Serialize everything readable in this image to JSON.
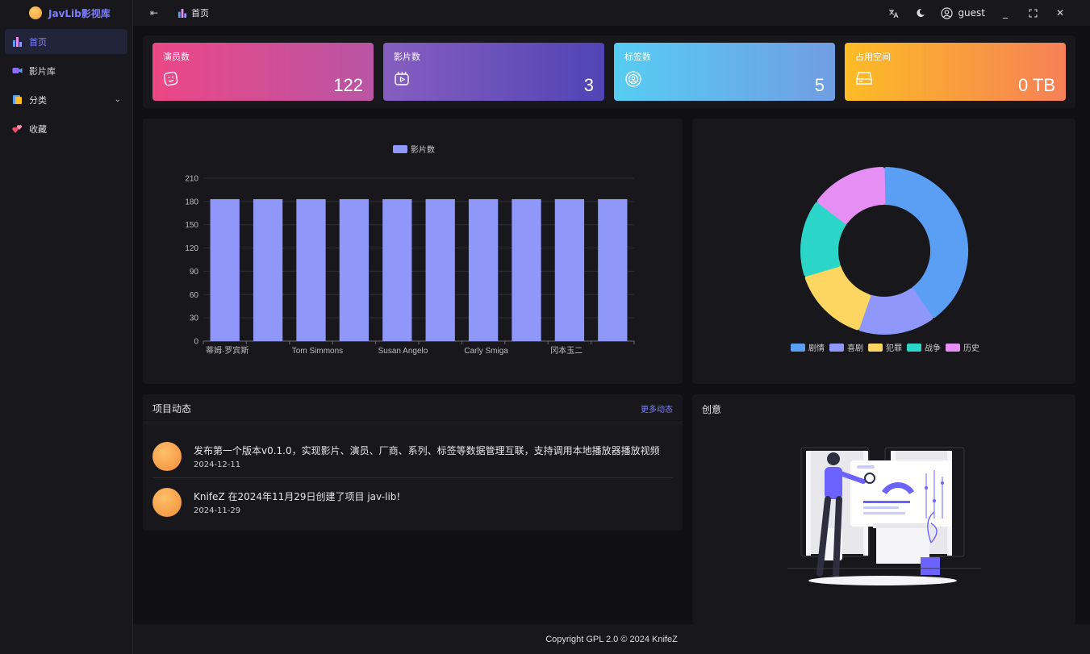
{
  "app": {
    "title": "JavLib影视库"
  },
  "sidebar": {
    "items": [
      {
        "label": "首页",
        "icon": "bar-chart-icon",
        "active": true
      },
      {
        "label": "影片库",
        "icon": "video-camera-icon"
      },
      {
        "label": "分类",
        "icon": "category-icon",
        "has_children": true
      },
      {
        "label": "收藏",
        "icon": "hearts-icon"
      }
    ]
  },
  "header": {
    "breadcrumb": "首页",
    "user_name": "guest"
  },
  "stats": [
    {
      "label": "演员数",
      "value": "122",
      "icon": "face-icon"
    },
    {
      "label": "影片数",
      "value": "3",
      "icon": "film-icon"
    },
    {
      "label": "标签数",
      "value": "5",
      "icon": "tag-icon"
    },
    {
      "label": "占用空间",
      "value": "0 TB",
      "icon": "disk-icon"
    }
  ],
  "chart_data": [
    {
      "type": "bar",
      "legend": [
        "影片数"
      ],
      "categories": [
        "蒂姆·罗宾斯",
        "",
        "Tom Simmons",
        "",
        "Susan Angelo",
        "",
        "Carly Smiga",
        "",
        "冈本玉二",
        ""
      ],
      "tick_labels": [
        "蒂姆·罗宾斯",
        "Tom Simmons",
        "Susan Angelo",
        "Carly Smiga",
        "冈本玉二"
      ],
      "series": [
        {
          "name": "影片数",
          "values": [
            183,
            183,
            183,
            183,
            183,
            183,
            183,
            183,
            183,
            183
          ]
        }
      ],
      "ylim": [
        0,
        210
      ],
      "yticks": [
        0,
        30,
        60,
        90,
        120,
        150,
        180,
        210
      ],
      "grid": true,
      "legend_position": "top-center",
      "color": "#8f97fb"
    },
    {
      "type": "pie",
      "variant": "donut",
      "slices": [
        {
          "name": "剧情",
          "value": 40,
          "color": "#5b9ff5"
        },
        {
          "name": "喜剧",
          "value": 15,
          "color": "#8f97fb"
        },
        {
          "name": "犯罪",
          "value": 15,
          "color": "#fcd660"
        },
        {
          "name": "战争",
          "value": 15,
          "color": "#2bd6c8"
        },
        {
          "name": "历史",
          "value": 15,
          "color": "#e58ff4"
        }
      ],
      "legend_position": "bottom-center"
    }
  ],
  "activity": {
    "title": "项目动态",
    "more_label": "更多动态",
    "items": [
      {
        "text": "发布第一个版本v0.1.0，实现影片、演员、厂商、系列、标签等数据管理互联，支持调用本地播放器播放视频",
        "date": "2024-12-11"
      },
      {
        "text": "KnifeZ 在2024年11月29日创建了项目 jav-lib!",
        "date": "2024-11-29"
      }
    ]
  },
  "idea": {
    "title": "创意"
  },
  "footer": {
    "copyright": "Copyright GPL 2.0 © 2024 KnifeZ"
  },
  "colors": {
    "accent": "#7b82f6",
    "background": "#101014",
    "panel": "#18181c"
  }
}
